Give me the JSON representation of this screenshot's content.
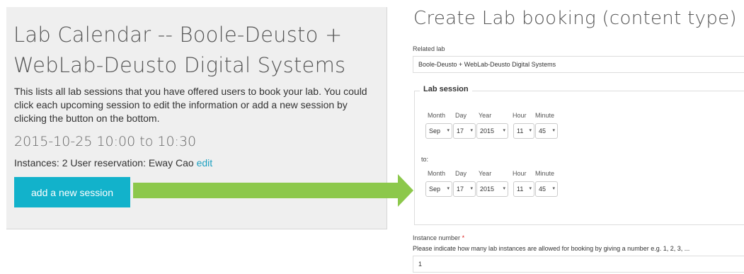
{
  "left": {
    "title": "Lab Calendar -- Boole-Deusto + WebLab-Deusto Digital Systems",
    "description": "This lists all lab sessions that you have offered users to book your lab. You could click each upcoming session to edit the information or add a new session by clicking the button on the bottom.",
    "session_time": "2015-10-25 10:00 to 10:30",
    "instances_text": "Instances: 2 User reservation: Eway Cao",
    "edit_link": "edit",
    "add_button": "add a new session"
  },
  "arrow_color": "#8cc84b",
  "right": {
    "title": "Create Lab booking (content type)",
    "related_lab_label": "Related lab",
    "related_lab_value": "Boole-Deusto + WebLab-Deusto Digital Systems",
    "lab_session_legend": "Lab session",
    "headers": {
      "month": "Month",
      "day": "Day",
      "year": "Year",
      "hour": "Hour",
      "minute": "Minute"
    },
    "start": {
      "month": "Sep",
      "day": "17",
      "year": "2015",
      "hour": "11",
      "minute": "45"
    },
    "to_label": "to:",
    "end": {
      "month": "Sep",
      "day": "17",
      "year": "2015",
      "hour": "11",
      "minute": "45"
    },
    "instance_label": "Instance number",
    "required_mark": "*",
    "instance_help": "Please indicate how many lab instances are allowed for booking by giving a number e.g. 1, 2, 3, ...",
    "instance_value": "1"
  },
  "icons": {
    "select_caret": "caret-down-icon",
    "arrow": "arrow-right-icon"
  }
}
